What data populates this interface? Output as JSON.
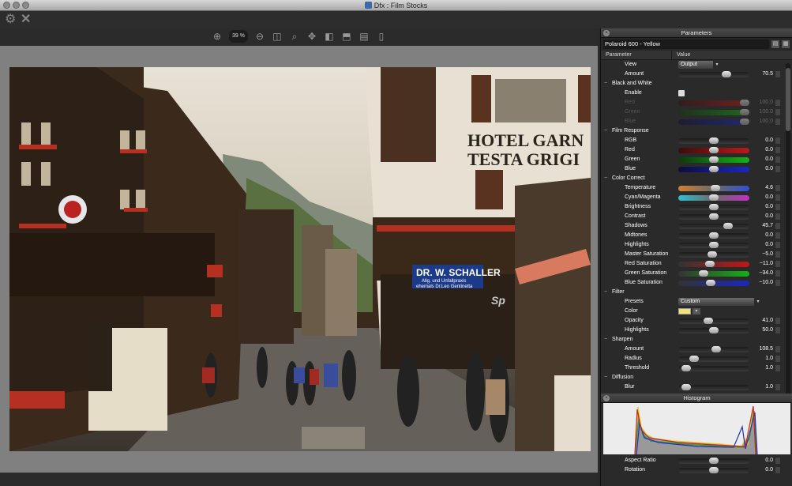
{
  "window": {
    "title": "Dfx : Film Stocks"
  },
  "viewer_toolbar": {
    "zoom": "39 %"
  },
  "parameters_panel": {
    "title": "Parameters",
    "preset_name": "Polaroid 600 - Yellow",
    "col_parameter": "Parameter",
    "col_value": "Value",
    "rows": [
      {
        "label": "View",
        "kind": "dropdown",
        "value": "Output",
        "level": "item"
      },
      {
        "label": "Amount",
        "kind": "slider",
        "value": "70.5",
        "pos": 0.705,
        "track": "gray",
        "level": "item"
      },
      {
        "label": "Black and White",
        "kind": "group",
        "level": "group",
        "toggle": "−"
      },
      {
        "label": "Enable",
        "kind": "checkbox",
        "level": "item"
      },
      {
        "label": "Red",
        "kind": "slider",
        "value": "100.0",
        "pos": 1.0,
        "track": "red",
        "level": "item",
        "disabled": true
      },
      {
        "label": "Green",
        "kind": "slider",
        "value": "100.0",
        "pos": 1.0,
        "track": "green",
        "level": "item",
        "disabled": true
      },
      {
        "label": "Blue",
        "kind": "slider",
        "value": "100.0",
        "pos": 1.0,
        "track": "blue",
        "level": "item",
        "disabled": true
      },
      {
        "label": "Film Response",
        "kind": "group",
        "level": "group",
        "toggle": "−"
      },
      {
        "label": "RGB",
        "kind": "slider",
        "value": "0.0",
        "pos": 0.5,
        "track": "gray",
        "level": "item"
      },
      {
        "label": "Red",
        "kind": "slider",
        "value": "0.0",
        "pos": 0.5,
        "track": "red",
        "level": "item"
      },
      {
        "label": "Green",
        "kind": "slider",
        "value": "0.0",
        "pos": 0.5,
        "track": "green",
        "level": "item"
      },
      {
        "label": "Blue",
        "kind": "slider",
        "value": "0.0",
        "pos": 0.5,
        "track": "blue",
        "level": "item"
      },
      {
        "label": "Color Correct",
        "kind": "group",
        "level": "group",
        "toggle": "−"
      },
      {
        "label": "Temperature",
        "kind": "slider",
        "value": "4.6",
        "pos": 0.52,
        "track": "temp",
        "level": "item"
      },
      {
        "label": "Cyan/Magenta",
        "kind": "slider",
        "value": "0.0",
        "pos": 0.5,
        "track": "cm",
        "level": "item"
      },
      {
        "label": "Brightness",
        "kind": "slider",
        "value": "0.0",
        "pos": 0.5,
        "track": "gray",
        "level": "item"
      },
      {
        "label": "Contrast",
        "kind": "slider",
        "value": "0.0",
        "pos": 0.5,
        "track": "gray",
        "level": "item"
      },
      {
        "label": "Shadows",
        "kind": "slider",
        "value": "45.7",
        "pos": 0.73,
        "track": "gray",
        "level": "item"
      },
      {
        "label": "Midtones",
        "kind": "slider",
        "value": "0.0",
        "pos": 0.5,
        "track": "gray",
        "level": "item"
      },
      {
        "label": "Highlights",
        "kind": "slider",
        "value": "0.0",
        "pos": 0.5,
        "track": "gray",
        "level": "item"
      },
      {
        "label": "Master Saturation",
        "kind": "slider",
        "value": "−5.0",
        "pos": 0.47,
        "track": "gray",
        "level": "item"
      },
      {
        "label": "Red Saturation",
        "kind": "slider",
        "value": "−11.0",
        "pos": 0.44,
        "track": "redsat",
        "level": "item"
      },
      {
        "label": "Green Saturation",
        "kind": "slider",
        "value": "−34.0",
        "pos": 0.33,
        "track": "greensat",
        "level": "item"
      },
      {
        "label": "Blue Saturation",
        "kind": "slider",
        "value": "−10.0",
        "pos": 0.45,
        "track": "bluesat",
        "level": "item"
      },
      {
        "label": "Filter",
        "kind": "group",
        "level": "group",
        "toggle": "−"
      },
      {
        "label": "Presets",
        "kind": "dropdown",
        "value": "Custom",
        "level": "item",
        "wide": true
      },
      {
        "label": "Color",
        "kind": "swatch",
        "level": "item"
      },
      {
        "label": "Opacity",
        "kind": "slider",
        "value": "41.0",
        "pos": 0.41,
        "track": "gray",
        "level": "item"
      },
      {
        "label": "Highlights",
        "kind": "slider",
        "value": "50.0",
        "pos": 0.5,
        "track": "gray",
        "level": "item"
      },
      {
        "label": "Sharpen",
        "kind": "group",
        "level": "group",
        "toggle": "−"
      },
      {
        "label": "Amount",
        "kind": "slider",
        "value": "108.5",
        "pos": 0.54,
        "track": "gray",
        "level": "item"
      },
      {
        "label": "Radius",
        "kind": "slider",
        "value": "1.0",
        "pos": 0.18,
        "track": "gray",
        "level": "item"
      },
      {
        "label": "Threshold",
        "kind": "slider",
        "value": "1.0",
        "pos": 0.05,
        "track": "gray",
        "level": "item"
      },
      {
        "label": "Diffusion",
        "kind": "group",
        "level": "group",
        "toggle": "−"
      },
      {
        "label": "Blur",
        "kind": "slider",
        "value": "1.0",
        "pos": 0.05,
        "track": "gray",
        "level": "item"
      }
    ]
  },
  "histogram_panel": {
    "title": "Histogram",
    "rows": [
      {
        "label": "Aspect Ratio",
        "value": "0.0",
        "pos": 0.5
      },
      {
        "label": "Rotation",
        "value": "0.0",
        "pos": 0.5
      }
    ]
  },
  "photo": {
    "sign_hotel_1": "HOTEL GARN",
    "sign_hotel_2": "TESTA GRIGI",
    "sign_schaller_1": "DR. W. SCHALLER",
    "sign_schaller_2": "Allg. und Unfallpraxis",
    "sign_schaller_3": "ehemals Dr.Leo Gentinetta",
    "sign_sport": "Sp"
  },
  "colors": {
    "panel_bg": "#2a2a2a",
    "viewer_bg": "#808080",
    "histogram_bg": "#ececec"
  }
}
